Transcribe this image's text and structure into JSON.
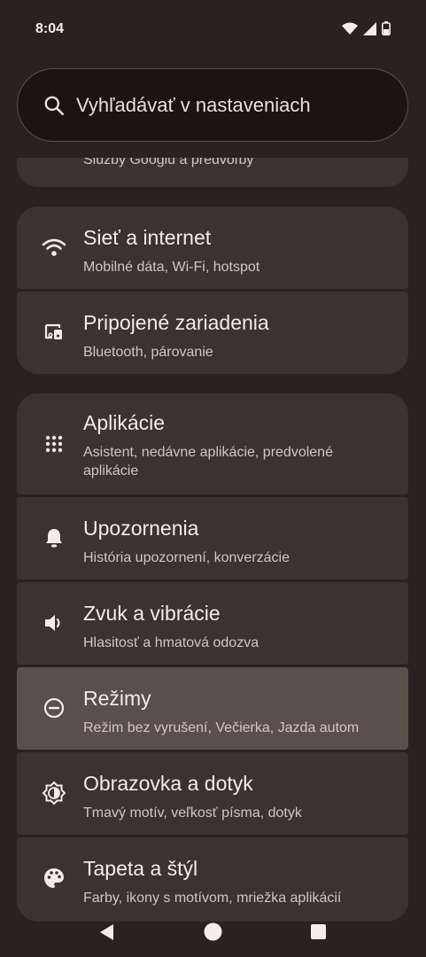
{
  "status_bar": {
    "time": "8:04"
  },
  "search": {
    "placeholder": "Vyhľadávať v nastaveniach"
  },
  "partial_item": {
    "subtitle": "Služby Googlu a predvoľby"
  },
  "groups": [
    {
      "items": [
        {
          "title": "Sieť a internet",
          "subtitle": "Mobilné dáta, Wi‑Fi, hotspot",
          "icon": "wifi-icon"
        },
        {
          "title": "Pripojené zariadenia",
          "subtitle": "Bluetooth, párovanie",
          "icon": "devices-icon"
        }
      ]
    },
    {
      "items": [
        {
          "title": "Aplikácie",
          "subtitle": "Asistent, nedávne aplikácie, predvolené aplikácie",
          "icon": "apps-grid-icon"
        },
        {
          "title": "Upozornenia",
          "subtitle": "História upozornení, konverzácie",
          "icon": "bell-icon"
        },
        {
          "title": "Zvuk a vibrácie",
          "subtitle": "Hlasitosť a hmatová odozva",
          "icon": "speaker-icon"
        },
        {
          "title": "Režimy",
          "subtitle": "Režim bez vyrušení, Večierka, Jazda autom",
          "icon": "minus-circle-icon"
        },
        {
          "title": "Obrazovka a dotyk",
          "subtitle": "Tmavý motív, veľkosť písma, dotyk",
          "icon": "brightness-icon"
        },
        {
          "title": "Tapeta a štýl",
          "subtitle": "Farby, ikony s motívom, mriežka aplikácií",
          "icon": "palette-icon"
        }
      ]
    }
  ],
  "colors": {
    "background": "#2a2120",
    "card": "#3c3230",
    "card_active": "#5b4f4c",
    "text": "#f4eae7",
    "subtext": "#d3c5c1"
  }
}
